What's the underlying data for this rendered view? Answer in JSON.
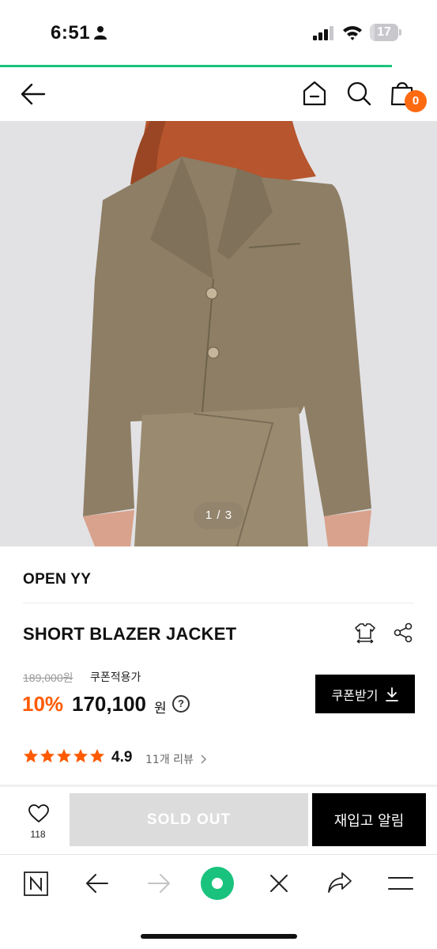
{
  "status_bar": {
    "time": "6:51",
    "battery": "17"
  },
  "nav": {
    "cart_count": "0"
  },
  "gallery": {
    "counter": "1 / 3"
  },
  "product": {
    "brand": "OPEN YY",
    "name": "SHORT BLAZER JACKET",
    "original_price": "189,000원",
    "coupon_label": "쿠폰적용가",
    "discount": "10%",
    "price": "170,100",
    "currency": "원",
    "coupon_button": "쿠폰받기",
    "rating": "4.9",
    "review_count": "11개 리뷰",
    "stars": 5
  },
  "actions": {
    "like_count": "118",
    "sold_out": "SOLD OUT",
    "restock": "재입고 알림"
  },
  "colors": {
    "accent": "#ff5a00",
    "brand_green": "#19c37d",
    "badge": "#ff6a10"
  },
  "icons": [
    "person-icon",
    "signal-icon",
    "wifi-icon",
    "back-arrow-icon",
    "home-icon",
    "search-icon",
    "cart-icon",
    "size-icon",
    "share-icon",
    "info-icon",
    "download-icon",
    "star-icon",
    "chevron-right-icon",
    "heart-icon",
    "naver-icon",
    "forward-icon",
    "green-dot-icon",
    "close-icon",
    "share-arrow-icon",
    "menu-icon"
  ]
}
